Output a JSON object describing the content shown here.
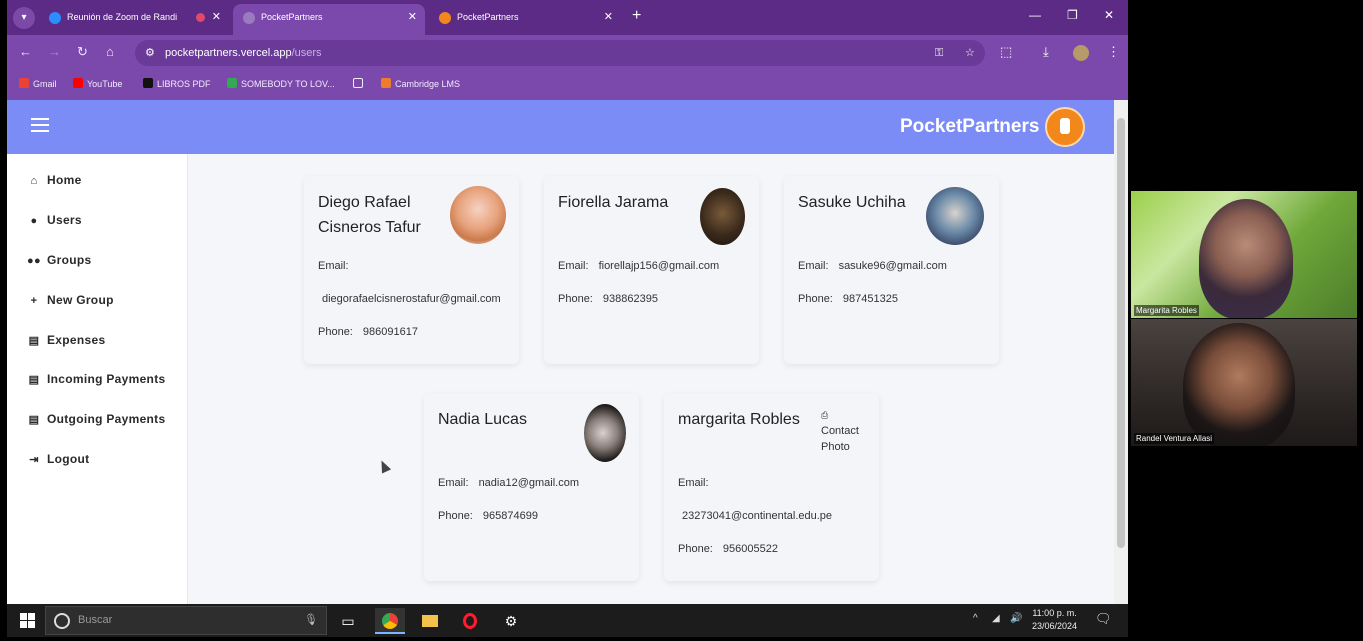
{
  "browser": {
    "tabs": [
      {
        "title": "Reunión de Zoom de Randi",
        "active": false
      },
      {
        "title": "PocketPartners",
        "active": true
      },
      {
        "title": "PocketPartners",
        "active": false
      }
    ],
    "url_host": "pocketpartners.vercel.app",
    "url_path": "/users",
    "bookmarks": [
      "Gmail",
      "YouTube",
      "LIBROS PDF",
      "SOMEBODY TO LOV...",
      "Cambridge LMS"
    ]
  },
  "app": {
    "brand": "PocketPartners",
    "nav": [
      {
        "label": "Home",
        "icon": "home-icon"
      },
      {
        "label": "Users",
        "icon": "person-icon"
      },
      {
        "label": "Groups",
        "icon": "people-icon"
      },
      {
        "label": "New Group",
        "icon": "plus-icon"
      },
      {
        "label": "Expenses",
        "icon": "card-icon"
      },
      {
        "label": "Incoming Payments",
        "icon": "card-icon"
      },
      {
        "label": "Outgoing Payments",
        "icon": "card-icon"
      },
      {
        "label": "Logout",
        "icon": "logout-icon"
      }
    ]
  },
  "users": [
    {
      "name": "Diego Rafael Cisneros Tafur",
      "email_label": "Email:",
      "email": "diegorafaelcisnerostafur@gmail.com",
      "phone_label": "Phone:",
      "phone": "986091617"
    },
    {
      "name": "Fiorella Jarama",
      "email_label": "Email:",
      "email": "fiorellajp156@gmail.com",
      "phone_label": "Phone:",
      "phone": "938862395"
    },
    {
      "name": "Sasuke Uchiha",
      "email_label": "Email:",
      "email": "sasuke96@gmail.com",
      "phone_label": "Phone:",
      "phone": "987451325"
    },
    {
      "name": "Nadia Lucas",
      "email_label": "Email:",
      "email": "nadia12@gmail.com",
      "phone_label": "Phone:",
      "phone": "965874699"
    },
    {
      "name": "margarita Robles",
      "email_label": "Email:",
      "email": "23273041@continental.edu.pe",
      "phone_label": "Phone:",
      "phone": "956005522",
      "photo_alt": "Contact Photo"
    }
  ],
  "taskbar": {
    "search_placeholder": "Buscar",
    "time": "11:00 p. m.",
    "date": "23/06/2024"
  },
  "video_call": {
    "participants": [
      "Margarita Robles",
      "Randel Ventura Allasi"
    ]
  }
}
